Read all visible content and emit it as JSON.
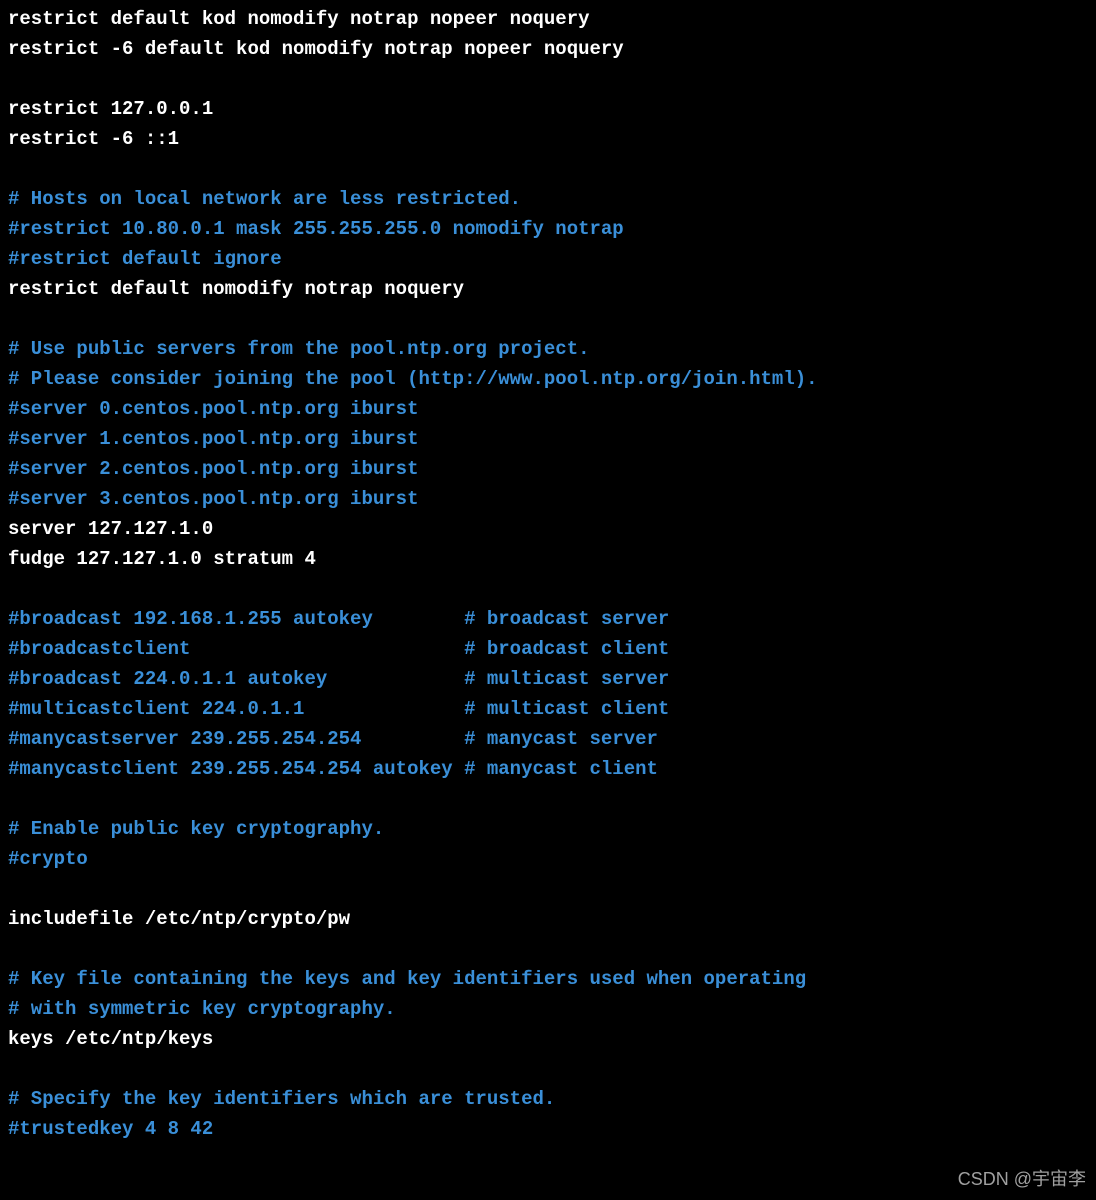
{
  "lines": [
    {
      "cls": "white",
      "text": "restrict default kod nomodify notrap nopeer noquery"
    },
    {
      "cls": "white",
      "text": "restrict -6 default kod nomodify notrap nopeer noquery"
    },
    {
      "cls": "white",
      "text": ""
    },
    {
      "cls": "white",
      "text": "restrict 127.0.0.1"
    },
    {
      "cls": "white",
      "text": "restrict -6 ::1"
    },
    {
      "cls": "white",
      "text": ""
    },
    {
      "cls": "blue",
      "text": "# Hosts on local network are less restricted."
    },
    {
      "cls": "blue",
      "text": "#restrict 10.80.0.1 mask 255.255.255.0 nomodify notrap"
    },
    {
      "cls": "blue",
      "text": "#restrict default ignore"
    },
    {
      "cls": "white",
      "text": "restrict default nomodify notrap noquery"
    },
    {
      "cls": "white",
      "text": ""
    },
    {
      "cls": "blue",
      "text": "# Use public servers from the pool.ntp.org project."
    },
    {
      "cls": "blue",
      "text": "# Please consider joining the pool (http://www.pool.ntp.org/join.html)."
    },
    {
      "cls": "blue",
      "text": "#server 0.centos.pool.ntp.org iburst"
    },
    {
      "cls": "blue",
      "text": "#server 1.centos.pool.ntp.org iburst"
    },
    {
      "cls": "blue",
      "text": "#server 2.centos.pool.ntp.org iburst"
    },
    {
      "cls": "blue",
      "text": "#server 3.centos.pool.ntp.org iburst"
    },
    {
      "cls": "white",
      "text": "server 127.127.1.0"
    },
    {
      "cls": "white",
      "text": "fudge 127.127.1.0 stratum 4"
    },
    {
      "cls": "white",
      "text": ""
    },
    {
      "cls": "blue",
      "text": "#broadcast 192.168.1.255 autokey        # broadcast server"
    },
    {
      "cls": "blue",
      "text": "#broadcastclient                        # broadcast client"
    },
    {
      "cls": "blue",
      "text": "#broadcast 224.0.1.1 autokey            # multicast server"
    },
    {
      "cls": "blue",
      "text": "#multicastclient 224.0.1.1              # multicast client"
    },
    {
      "cls": "blue",
      "text": "#manycastserver 239.255.254.254         # manycast server"
    },
    {
      "cls": "blue",
      "text": "#manycastclient 239.255.254.254 autokey # manycast client"
    },
    {
      "cls": "white",
      "text": ""
    },
    {
      "cls": "blue",
      "text": "# Enable public key cryptography."
    },
    {
      "cls": "blue",
      "text": "#crypto"
    },
    {
      "cls": "white",
      "text": ""
    },
    {
      "cls": "white",
      "text": "includefile /etc/ntp/crypto/pw"
    },
    {
      "cls": "white",
      "text": ""
    },
    {
      "cls": "blue",
      "text": "# Key file containing the keys and key identifiers used when operating"
    },
    {
      "cls": "blue",
      "text": "# with symmetric key cryptography."
    },
    {
      "cls": "white",
      "text": "keys /etc/ntp/keys"
    },
    {
      "cls": "white",
      "text": ""
    },
    {
      "cls": "blue",
      "text": "# Specify the key identifiers which are trusted."
    },
    {
      "cls": "blue",
      "text": "#trustedkey 4 8 42"
    }
  ],
  "watermark": "CSDN @宇宙李"
}
